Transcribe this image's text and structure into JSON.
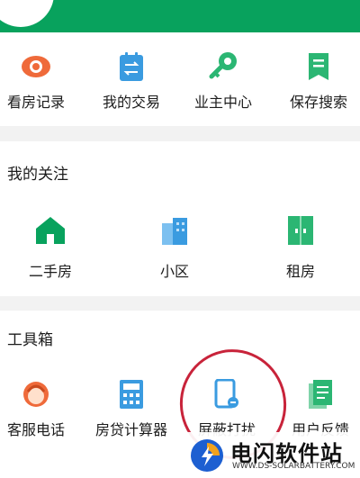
{
  "quick_actions": [
    {
      "label": "看房记录",
      "icon": "eye-record-icon"
    },
    {
      "label": "我的交易",
      "icon": "transaction-icon"
    },
    {
      "label": "业主中心",
      "icon": "key-icon"
    },
    {
      "label": "保存搜索",
      "icon": "bookmark-list-icon"
    }
  ],
  "follow": {
    "title": "我的关注",
    "items": [
      {
        "label": "二手房",
        "icon": "house-icon"
      },
      {
        "label": "小区",
        "icon": "buildings-icon"
      },
      {
        "label": "租房",
        "icon": "door-icon"
      }
    ]
  },
  "tools": {
    "title": "工具箱",
    "items": [
      {
        "label": "客服电话",
        "icon": "customer-service-icon"
      },
      {
        "label": "房贷计算器",
        "icon": "calculator-icon"
      },
      {
        "label": "屏蔽打扰",
        "icon": "block-disturb-icon"
      },
      {
        "label": "用户反馈",
        "icon": "feedback-icon"
      }
    ]
  },
  "watermark": {
    "title": "电闪软件站",
    "url": "WWW.DS-SOLARBATTERY.COM"
  },
  "colors": {
    "brand_green": "#08a25d",
    "icon_orange": "#ef6a3a",
    "icon_blue": "#3a9be0",
    "icon_green": "#2bb673",
    "annotation_red": "#c8233a"
  }
}
